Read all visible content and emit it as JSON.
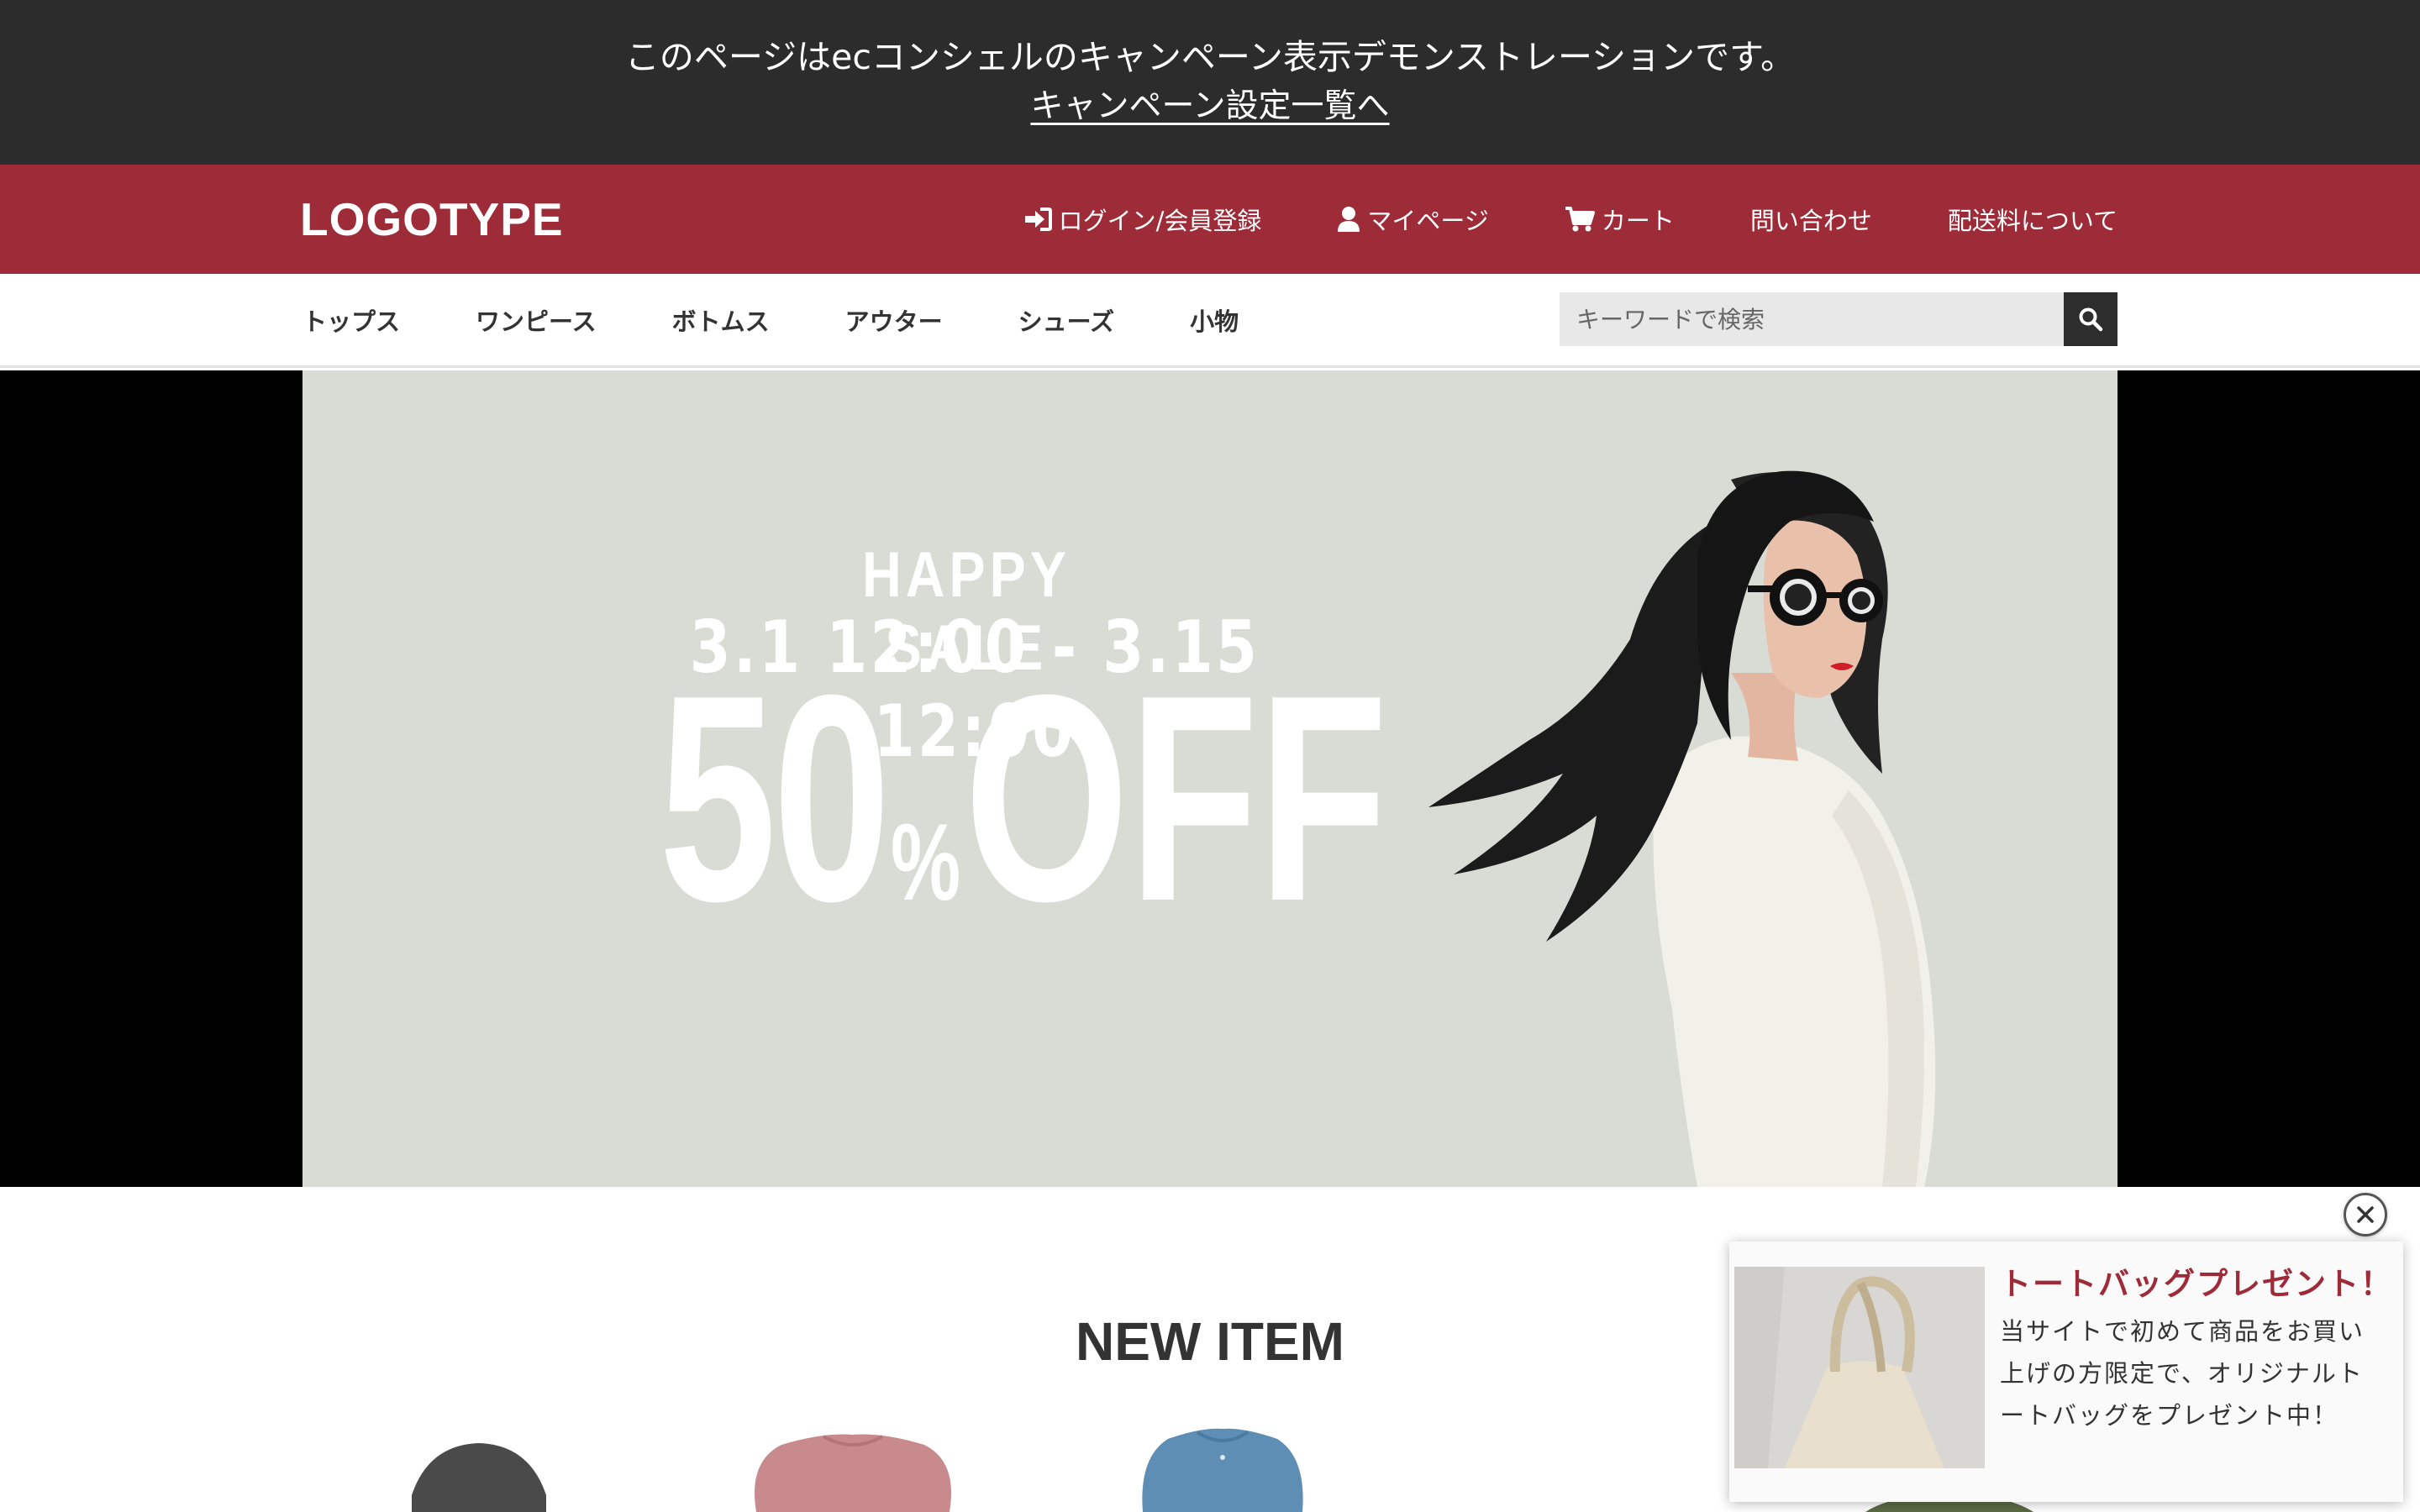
{
  "demo_notice": {
    "message": "このページはecコンシェルのキャンペーン表示デモンストレーションです。",
    "link": "キャンペーン設定一覧へ"
  },
  "header": {
    "logo": "LOGOTYPE",
    "nav": [
      {
        "label": "ログイン/会員登録",
        "icon": "sign-in-icon"
      },
      {
        "label": "マイページ",
        "icon": "user-icon"
      },
      {
        "label": "カート",
        "icon": "cart-icon"
      },
      {
        "label": "問い合わせ",
        "icon": ""
      },
      {
        "label": "配送料について",
        "icon": ""
      }
    ]
  },
  "categories": [
    "トップス",
    "ワンピース",
    "ボトムス",
    "アウター",
    "シューズ",
    "小物"
  ],
  "search": {
    "placeholder": "キーワードで検索"
  },
  "hero": {
    "heading": "HAPPY SALE",
    "period": "3.1 12:00 - 3.15 12:00",
    "discount_number": "50",
    "discount_percent": "%",
    "discount_word": "OFF"
  },
  "new_item": {
    "title": "NEW ITEM"
  },
  "popup": {
    "title": "トートバッグプレゼント！",
    "body": "当サイトで初めて商品をお買い上げの方限定で、オリジナルトートバッグをプレゼント中！"
  },
  "colors": {
    "notice_bg": "#2c2c2c",
    "header_bg": "#9e2b38",
    "banner_bg": "#d9dbd5",
    "popup_title": "#9e2b38"
  }
}
